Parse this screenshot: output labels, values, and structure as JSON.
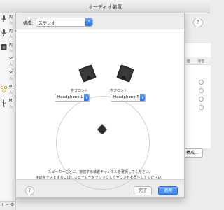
{
  "window": {
    "title": "オーディオ装置"
  },
  "sidebar": {
    "items": [
      {
        "name": "内",
        "sub": "入",
        "icon": "microphone-icon"
      },
      {
        "name": "内",
        "sub": "入",
        "icon": "microphone-icon"
      },
      {
        "name": "内",
        "sub": "入",
        "icon": "speaker-icon"
      },
      {
        "name": "So",
        "sub": "入",
        "icon": "soundflower-icon"
      },
      {
        "name": "So",
        "sub": "入",
        "icon": "soundflower-icon"
      },
      {
        "name": "M",
        "sub": "入",
        "icon": "aggregate-device-icon"
      },
      {
        "name": "M",
        "sub": "入",
        "icon": "usb-icon"
      }
    ],
    "bottom_controls": "+ − ⚙"
  },
  "background_panel": {
    "col1": "値",
    "col2": "消音",
    "configure_button": "を構成..."
  },
  "sheet": {
    "config_label": "構成:",
    "config_value": "ステレオ",
    "left_speaker_label": "左フロント",
    "right_speaker_label": "右フロント",
    "left_channel_value": "Headphone L",
    "right_channel_value": "Headphone R",
    "instruction_line1": "スピーカーごとに、接続する装置チャンネルを選択してください。",
    "instruction_line2": "接続をテストするには、スピーカーをクリックしてサウンドを再生してください。",
    "help": "?",
    "done_button": "完了",
    "apply_button": "適用"
  },
  "colors": {
    "accent": "#2f78ea",
    "speaker": "#2a2a2a"
  }
}
